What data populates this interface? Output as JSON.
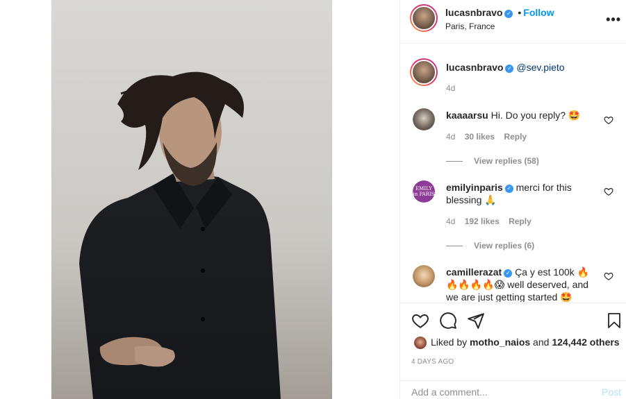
{
  "header": {
    "username": "lucasnbravo",
    "follow_label": "Follow",
    "location": "Paris, France",
    "more_label": "•••",
    "bullet": "•"
  },
  "caption": {
    "username": "lucasnbravo",
    "mention": "@sev.pieto",
    "time": "4d"
  },
  "comments": [
    {
      "username": "kaaaarsu",
      "text": "Hi. Do you reply? 🤩",
      "time": "4d",
      "likes": "30 likes",
      "reply_label": "Reply",
      "view_replies": "View replies (58)"
    },
    {
      "username": "emilyinparis",
      "avatar_text": "EMILY in PARIS",
      "text_line1": "merci for this",
      "text_line2": "blessing 🙏",
      "time": "4d",
      "likes": "192 likes",
      "reply_label": "Reply",
      "view_replies": "View replies (6)"
    },
    {
      "username": "camillerazat",
      "text_line1": "Ça y est 100k 🔥",
      "text_line2": "🔥🔥🔥🔥😱 well deserved, and",
      "text_line3": "we are just getting started 🤩"
    }
  ],
  "likes_summary": {
    "prefix": "Liked by ",
    "user": "motho_naios",
    "middle": " and ",
    "count": "124,442 others"
  },
  "post_date": "4 DAYS AGO",
  "add_comment": {
    "placeholder": "Add a comment...",
    "post_label": "Post"
  },
  "colors": {
    "accent": "#0095f6",
    "verified": "#3897f0",
    "post_disabled": "#b2dffc"
  }
}
